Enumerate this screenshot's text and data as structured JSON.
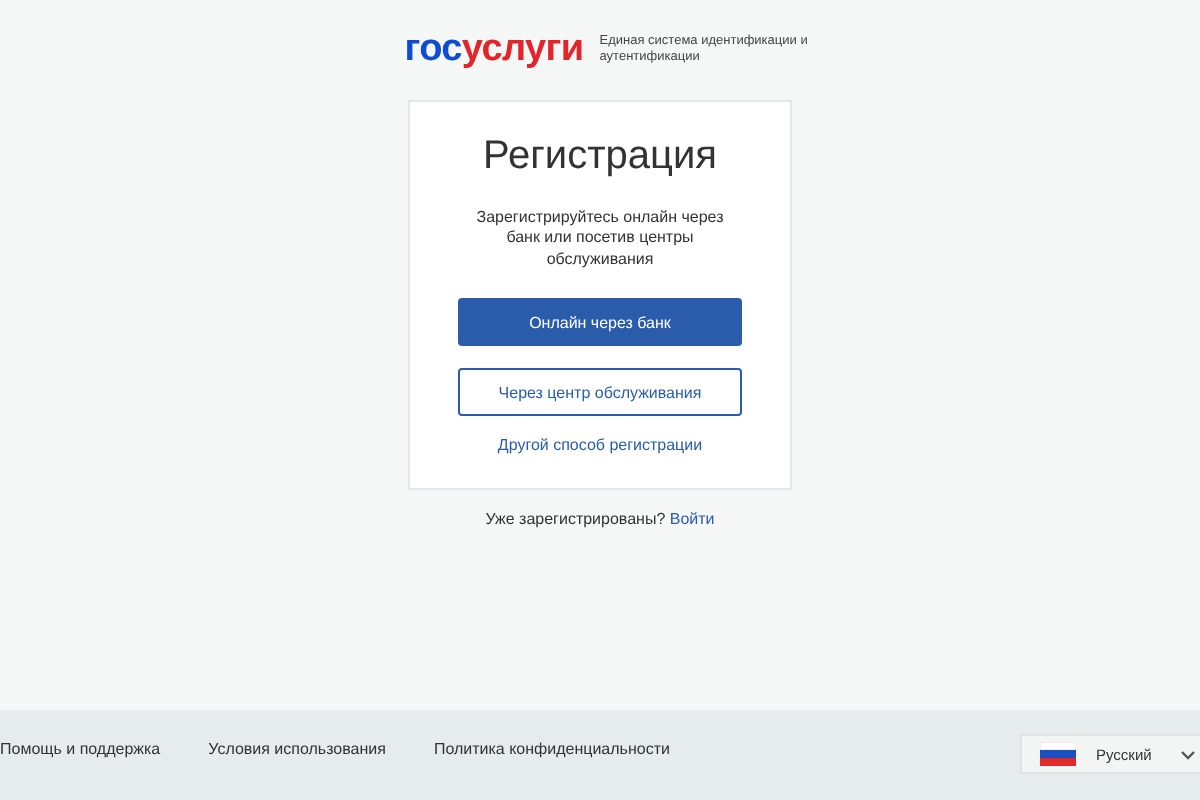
{
  "logo": {
    "parts": [
      {
        "text": "гос",
        "color": "#0d4cd3"
      },
      {
        "text": "услуги",
        "color": "#e3242b"
      }
    ],
    "tagline": "Единая система идентификации и аутентификации"
  },
  "card": {
    "title": "Регистрация",
    "description": "Зарегистрируйтесь онлайн через банк или посетив центры обслуживания",
    "buttons": [
      {
        "label": "Онлайн через банк",
        "kind": "primary"
      },
      {
        "label": "Через центр обслуживания",
        "kind": "outline"
      }
    ],
    "link": "Другой способ регистрации"
  },
  "login": {
    "text": "Уже зарегистрированы?",
    "link": "Войти"
  },
  "footer": {
    "links": [
      "Помощь и поддержка",
      "Условия использования",
      "Политика конфиденциальности"
    ],
    "language": "Русский"
  }
}
